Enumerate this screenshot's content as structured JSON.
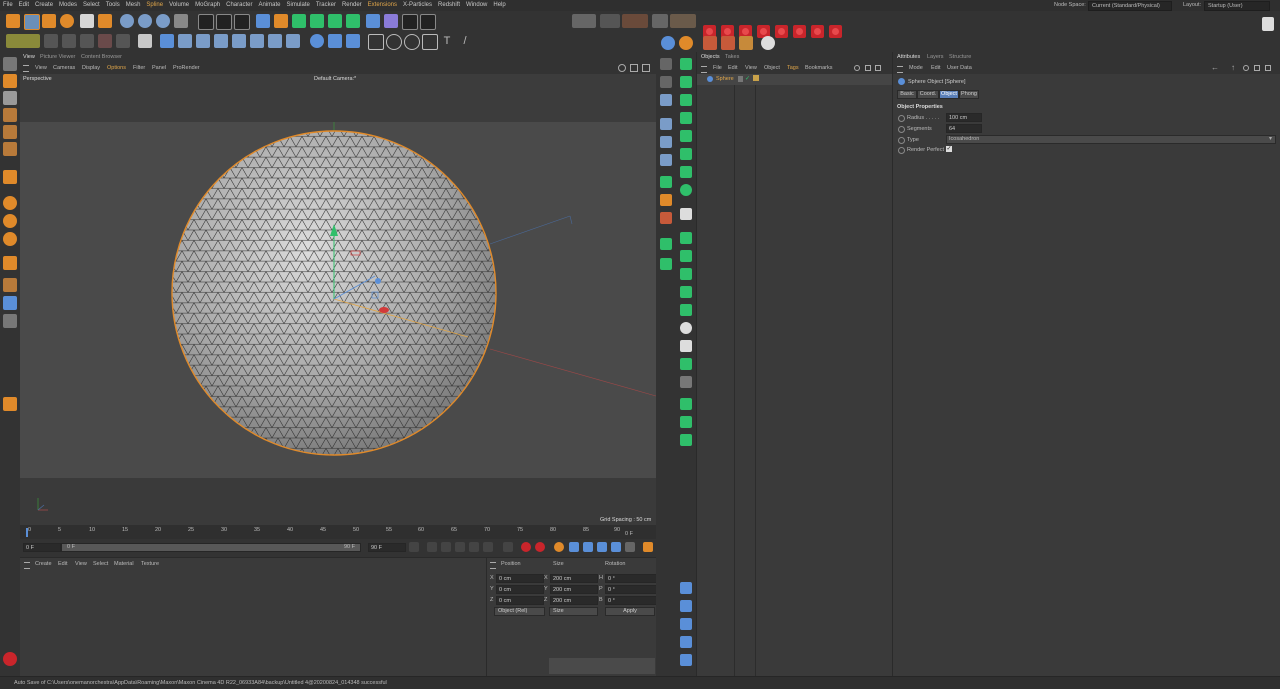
{
  "menu": [
    "File",
    "Edit",
    "Create",
    "Modes",
    "Select",
    "Tools",
    "Mesh",
    "Spline",
    "Volume",
    "MoGraph",
    "Character",
    "Animate",
    "Simulate",
    "Tracker",
    "Render",
    "Extensions",
    "X-Particles",
    "Redshift",
    "Window",
    "Help"
  ],
  "node_space": {
    "label": "Node Space:",
    "value": "Current (Standard/Physical)"
  },
  "layout": {
    "label": "Layout:",
    "value": "Startup (User)"
  },
  "viewport": {
    "tabs": [
      "View",
      "Picture Viewer",
      "Content Browser"
    ],
    "menu": [
      "View",
      "Cameras",
      "Display",
      "Options",
      "Filter",
      "Panel",
      "ProRender"
    ],
    "label": "Perspective",
    "camera": "Default Camera:*",
    "grid_spacing": "Grid Spacing : 50 cm"
  },
  "timeline": {
    "ticks": [
      "0",
      "5",
      "10",
      "15",
      "20",
      "25",
      "30",
      "35",
      "40",
      "45",
      "50",
      "55",
      "60",
      "65",
      "70",
      "75",
      "80",
      "85",
      "90"
    ],
    "current_frame": "0 F",
    "start": "0 F",
    "slider_start": "0 F",
    "slider_end": "90 F",
    "end": "90 F"
  },
  "material_menu": [
    "Create",
    "Edit",
    "View",
    "Select",
    "Material",
    "Texture"
  ],
  "coords": {
    "headers": [
      "Position",
      "Size",
      "Rotation"
    ],
    "rows": [
      {
        "axis": "X",
        "pos": "0 cm",
        "size_axis": "X",
        "size": "200 cm",
        "rot_axis": "H",
        "rot": "0 °"
      },
      {
        "axis": "Y",
        "pos": "0 cm",
        "size_axis": "Y",
        "size": "200 cm",
        "rot_axis": "P",
        "rot": "0 °"
      },
      {
        "axis": "Z",
        "pos": "0 cm",
        "size_axis": "Z",
        "size": "200 cm",
        "rot_axis": "B",
        "rot": "0 °"
      }
    ],
    "mode": "Object (Rel)",
    "size_mode": "Size",
    "apply": "Apply"
  },
  "objects": {
    "tabs": [
      "Objects",
      "Takes"
    ],
    "menu": [
      "File",
      "Edit",
      "View",
      "Object",
      "Tags",
      "Bookmarks"
    ],
    "items": [
      {
        "name": "Sphere"
      }
    ]
  },
  "attributes": {
    "tabs": [
      "Attributes",
      "Layers",
      "Structure"
    ],
    "menu": [
      "Mode",
      "Edit",
      "User Data"
    ],
    "object_title": "Sphere Object [Sphere]",
    "subtabs": [
      "Basic",
      "Coord.",
      "Object",
      "Phong"
    ],
    "active_subtab": "Object",
    "section": "Object Properties",
    "props": [
      {
        "label": "Radius . . . . .",
        "value": "100 cm"
      },
      {
        "label": "Segments",
        "value": "64"
      },
      {
        "label": "Type",
        "value": "Icosahedron"
      },
      {
        "label": "Render Perfect",
        "value": "checked"
      }
    ]
  },
  "statusbar": "Auto Save of C:\\Users\\onemanorchestra\\AppData\\Roaming\\Maxon\\Maxon Cinema 4D R22_06933A84\\backup\\Untitled 4@20200824_014348 successful",
  "colors": {
    "accent": "#e08a2a",
    "red_tool": "#c9252b",
    "green_tool": "#2fbf6a",
    "blue_tool": "#5a8fd8"
  }
}
